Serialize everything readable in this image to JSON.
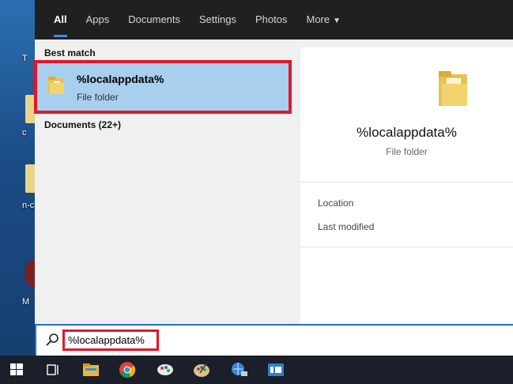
{
  "tabs": [
    {
      "label": "All"
    },
    {
      "label": "Apps"
    },
    {
      "label": "Documents"
    },
    {
      "label": "Settings"
    },
    {
      "label": "Photos"
    },
    {
      "label": "More"
    }
  ],
  "left": {
    "best_match_heading": "Best match",
    "best_match": {
      "title": "%localappdata%",
      "subtitle": "File folder",
      "icon": "folder-icon"
    },
    "documents_heading": "Documents (22+)"
  },
  "preview": {
    "title": "%localappdata%",
    "subtitle": "File folder",
    "location_label": "Location",
    "last_modified_label": "Last modified",
    "icon": "folder-icon"
  },
  "search": {
    "value": "%localappdata%"
  },
  "desktop": {
    "icon_letters": [
      "T",
      "c",
      "n-c",
      "M"
    ]
  },
  "taskbar": {
    "icons": [
      "windows-start-icon",
      "task-view-icon",
      "file-explorer-icon",
      "chrome-icon",
      "paint-icon",
      "palette-icon",
      "network-icon",
      "news-icon"
    ]
  },
  "colors": {
    "accent": "#1f6fd1",
    "highlight_box": "#e0172b",
    "selected_row": "#a9cfee",
    "tabs_bar": "#202020",
    "taskbar": "#1a1f2a"
  }
}
